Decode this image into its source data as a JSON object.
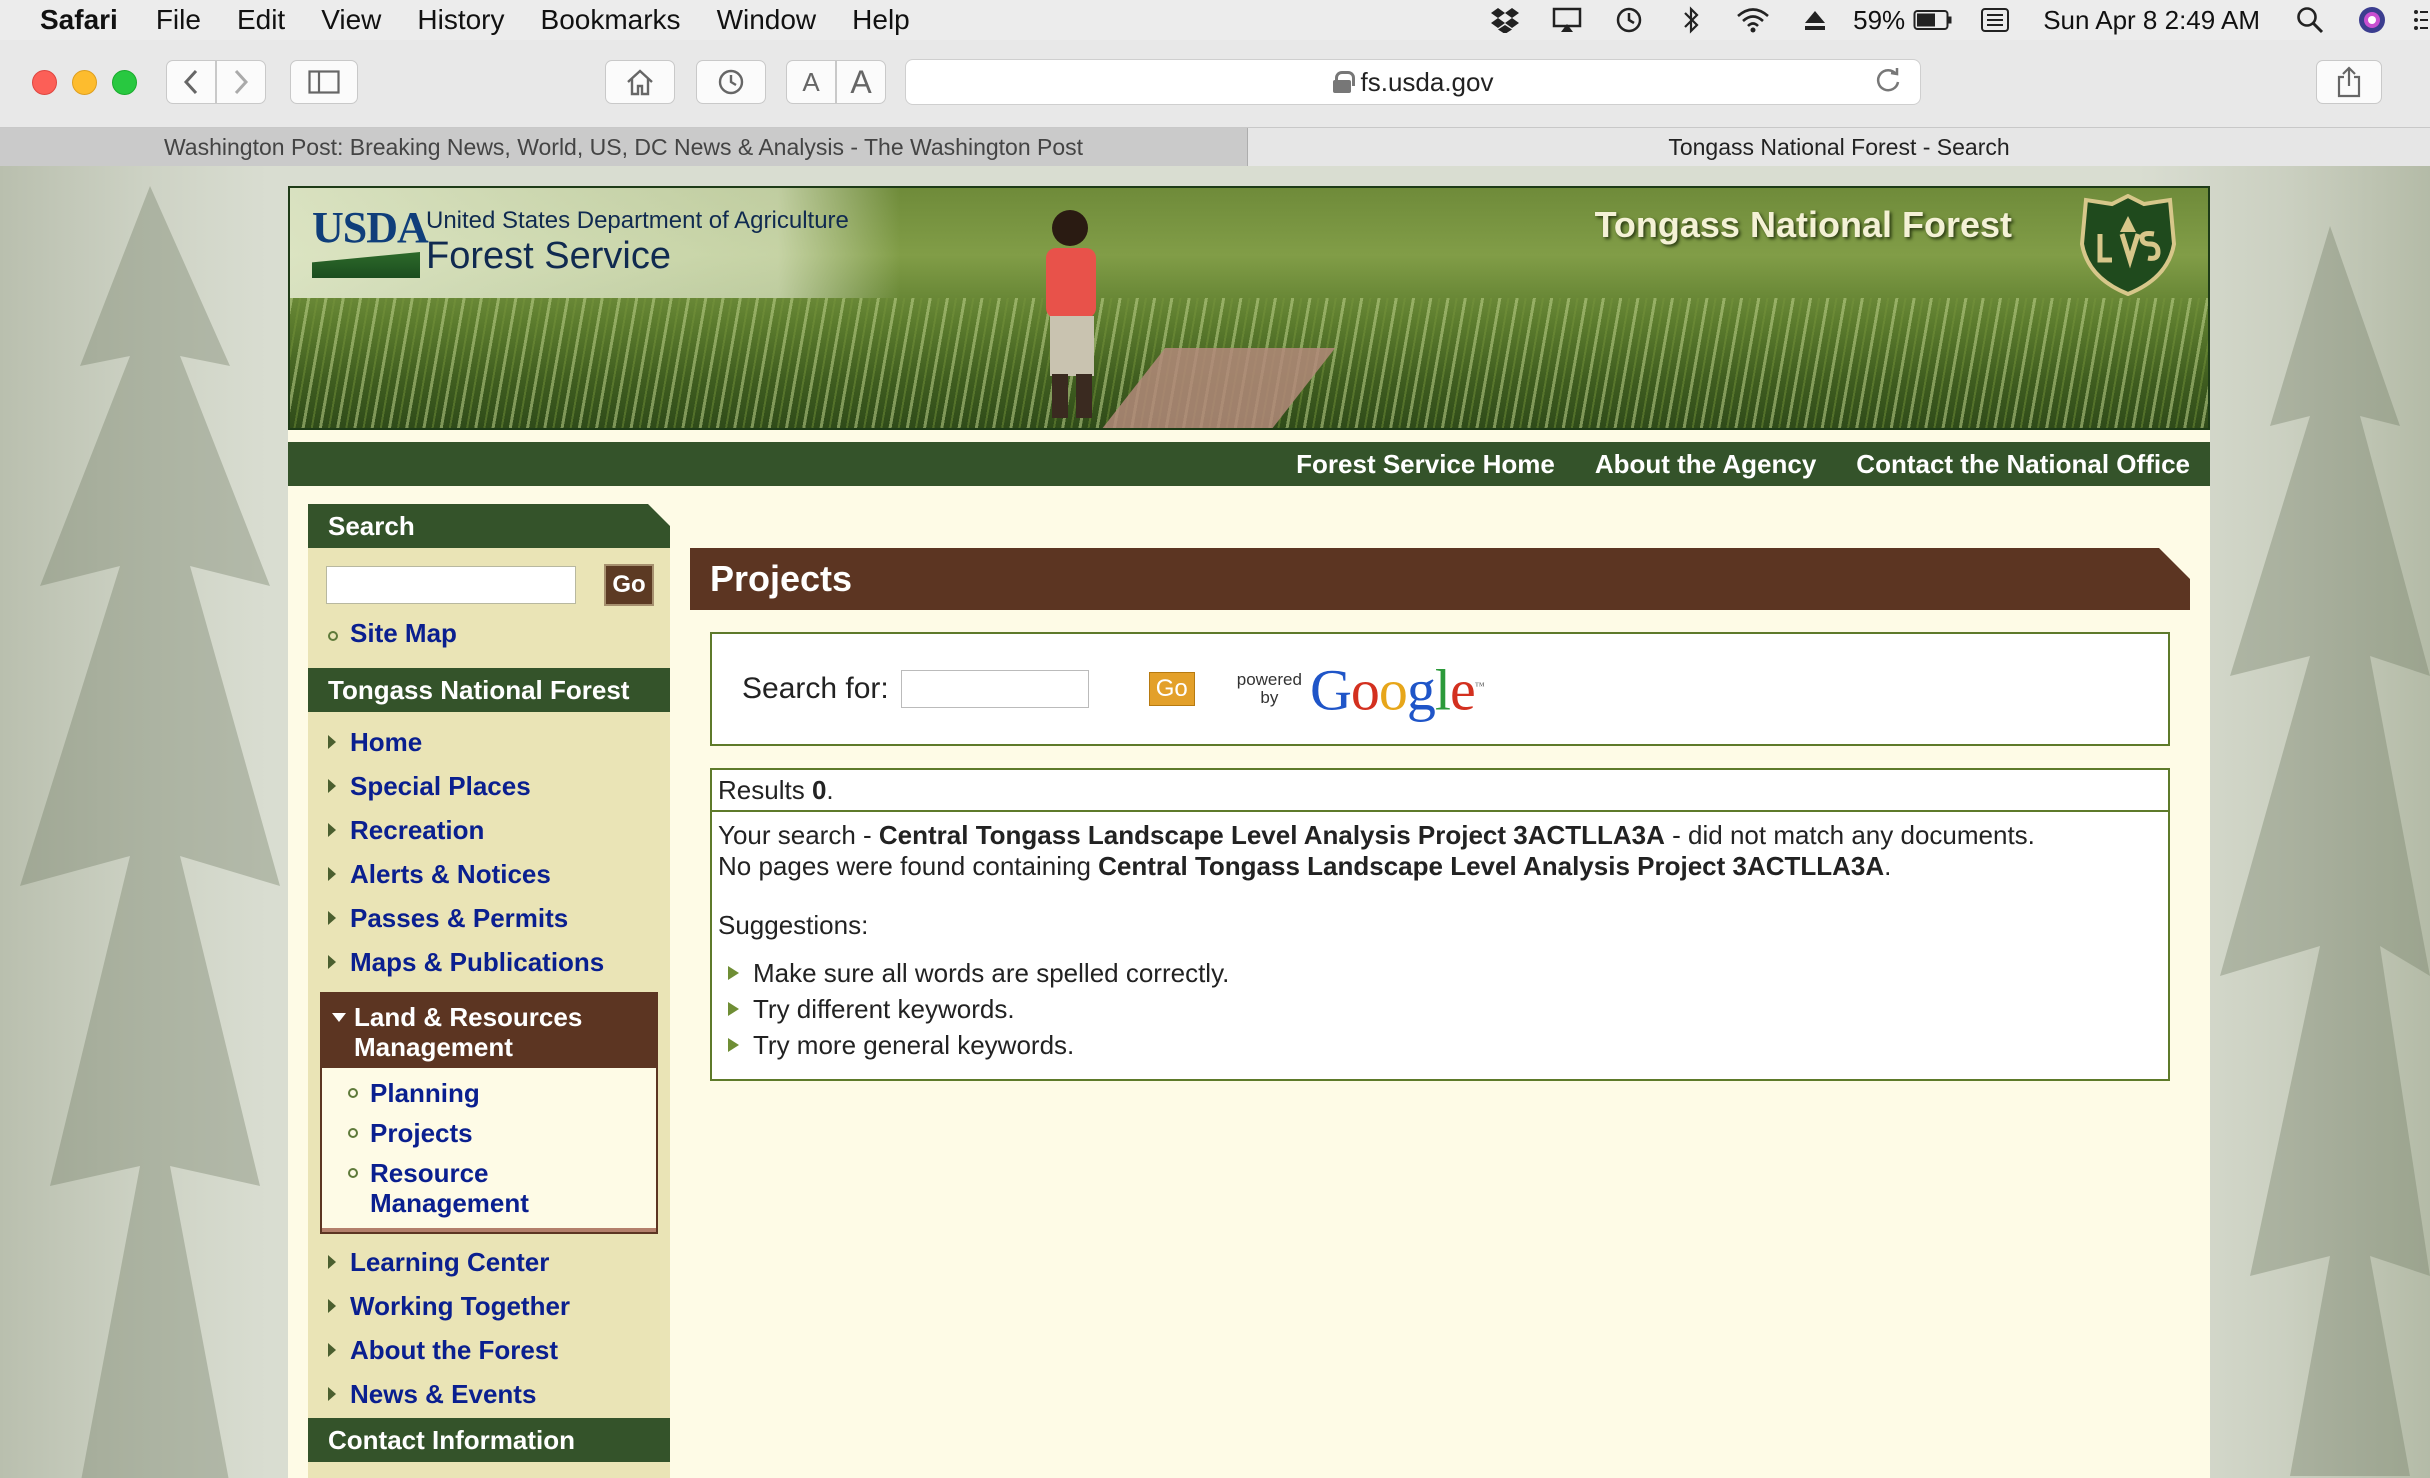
{
  "menubar": {
    "app": "Safari",
    "items": [
      "File",
      "Edit",
      "View",
      "History",
      "Bookmarks",
      "Window",
      "Help"
    ],
    "battery": "59%",
    "clock": "Sun Apr 8  2:49 AM"
  },
  "browser": {
    "url": "fs.usda.gov",
    "font_small": "A",
    "font_large": "A",
    "tabs": [
      {
        "title": "Washington Post: Breaking News, World, US, DC News & Analysis - The Washington Post",
        "active": false
      },
      {
        "title": "Tongass National Forest - Search",
        "active": true
      }
    ]
  },
  "header": {
    "usda": "USDA",
    "department": "United States Department of Agriculture",
    "agency": "Forest Service",
    "forest_name": "Tongass National Forest",
    "top_nav": [
      "Forest Service Home",
      "About the Agency",
      "Contact the National Office"
    ]
  },
  "sidebar": {
    "search_heading": "Search",
    "go_label": "Go",
    "site_map": "Site Map",
    "forest_heading": "Tongass National Forest",
    "nav": [
      "Home",
      "Special Places",
      "Recreation",
      "Alerts & Notices",
      "Passes & Permits",
      "Maps & Publications"
    ],
    "expanded_section": "Land & Resources Management",
    "expanded_items": [
      "Planning",
      "Projects",
      "Resource Management"
    ],
    "nav_after": [
      "Learning Center",
      "Working Together",
      "About the Forest",
      "News & Events"
    ],
    "contact_heading": "Contact Information"
  },
  "main": {
    "title": "Projects",
    "search_label": "Search for:",
    "search_value": "",
    "go_label": "Go",
    "powered_by": [
      "powered",
      "by"
    ],
    "google_letters": [
      "G",
      "o",
      "o",
      "g",
      "l",
      "e"
    ],
    "google_colors": [
      "#1f55c8",
      "#d3301f",
      "#e7a61a",
      "#1f55c8",
      "#2c9a3a",
      "#d3301f"
    ],
    "results_prefix": "Results ",
    "results_count": "0",
    "results_suffix": ".",
    "msg1_prefix": "Your search - ",
    "query": "Central Tongass Landscape Level Analysis Project 3ACTLLA3A",
    "msg1_suffix": " - did not match any documents.",
    "msg2_prefix": "No pages were found containing ",
    "msg2_suffix": ".",
    "suggestions_heading": "Suggestions:",
    "suggestions": [
      "Make sure all words are spelled correctly.",
      "Try different keywords.",
      "Try more general keywords."
    ]
  },
  "colors": {
    "nav_green": "#34532a",
    "section_brown": "#5c3522",
    "link_blue": "#0a1f8f",
    "panel_border": "#5e7a2a"
  }
}
